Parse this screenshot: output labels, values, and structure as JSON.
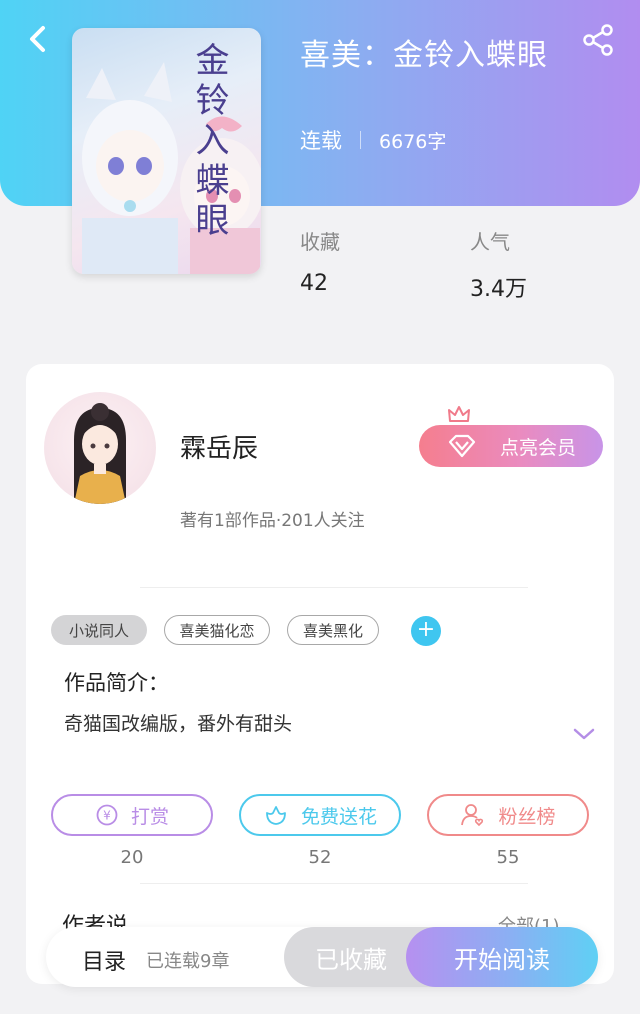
{
  "header": {
    "back_icon": "chevron-left-icon",
    "share_icon": "share-icon"
  },
  "book": {
    "title": "喜美：金铃入蝶眼",
    "cover_title": "金铃入蝶眼",
    "status": "连载",
    "word_count": "6676字",
    "stats": [
      {
        "label": "收藏",
        "value": "42"
      },
      {
        "label": "人气",
        "value": "3.4万"
      }
    ]
  },
  "author": {
    "name": "霖岳辰",
    "meta": "著有1部作品·201人关注",
    "vip_label": "点亮会员"
  },
  "tags": [
    "小说同人",
    "喜美猫化恋",
    "喜美黑化"
  ],
  "intro": {
    "heading": "作品简介：",
    "text": "奇猫国改编版，番外有甜头"
  },
  "actions": [
    {
      "label": "打赏",
      "count": "20",
      "icon": "yen-icon",
      "color": "#b98de6"
    },
    {
      "label": "免费送花",
      "count": "52",
      "icon": "flower-icon",
      "color": "#4cc9ec"
    },
    {
      "label": "粉丝榜",
      "count": "55",
      "icon": "fan-user-icon",
      "color": "#f08a8a"
    }
  ],
  "author_say": {
    "heading": "作者说",
    "all_label": "全部(1)"
  },
  "bottom_bar": {
    "toc_label": "目录",
    "chapters": "已连载9章",
    "collect_label": "已收藏",
    "read_label": "开始阅读"
  },
  "colors": {
    "header_gradient_start": "#4fd3f5",
    "header_gradient_end": "#b18df0",
    "accent_blue": "#3fc6f0"
  }
}
